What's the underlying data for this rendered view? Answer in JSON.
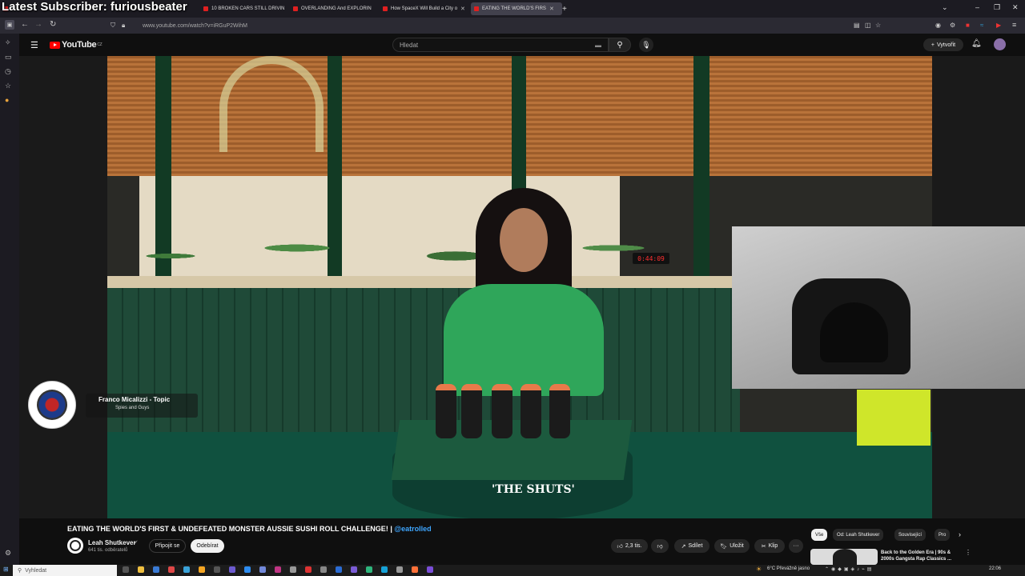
{
  "stream_overlay": {
    "title": "Latest Subscriber: furiousbeater"
  },
  "browser": {
    "tabs": [
      {
        "label": "",
        "active": false
      },
      {
        "label": "10 BROKEN CARS STILL DRIVIN",
        "active": false
      },
      {
        "label": "OVERLANDING And EXPLORIN",
        "active": false
      },
      {
        "label": "How SpaceX Will Build a City o",
        "active": false
      },
      {
        "label": "EATING THE WORLD'S FIRS",
        "active": true
      }
    ],
    "url": "www.youtube.com/watch?v=iRGuP2WihM"
  },
  "youtube": {
    "logo_text": "YouTube",
    "logo_region": "CZ",
    "search_placeholder": "Hledat",
    "create_label": "Vytvořit"
  },
  "video": {
    "timer_display": "0:44:09",
    "caption": "'THE SHUTS'",
    "music": {
      "artist": "Franco Micalizzi - Topic",
      "song": "Spies and Guys"
    }
  },
  "watch": {
    "title": "EATING THE WORLD'S FIRST & UNDEFEATED MONSTER AUSSIE SUSHI ROLL CHALLENGE! |",
    "title_tag": "@eatrolled",
    "channel": {
      "name": "Leah Shutkever",
      "subscribers": "641 tis. odběratelů"
    },
    "join_label": "Připojit se",
    "unsubscribe_label": "Odebírat",
    "actions": {
      "like_count": "2,3 tis.",
      "share": "Sdílet",
      "save": "Uložit",
      "clip": "Klip"
    }
  },
  "related": {
    "chips": [
      "Vše",
      "Od: Leah Shutkever",
      "Související",
      "Pro"
    ],
    "first_title": "Back to the Golden Era | 90s & 2000s Gangsta Rap Classics ..."
  },
  "taskbar": {
    "search_placeholder": "Vyhledat",
    "weather": "6°C  Převážně jasno",
    "time": "22:06"
  },
  "colors": {
    "accent_red": "#ff0000",
    "link_blue": "#3ea6ff"
  }
}
